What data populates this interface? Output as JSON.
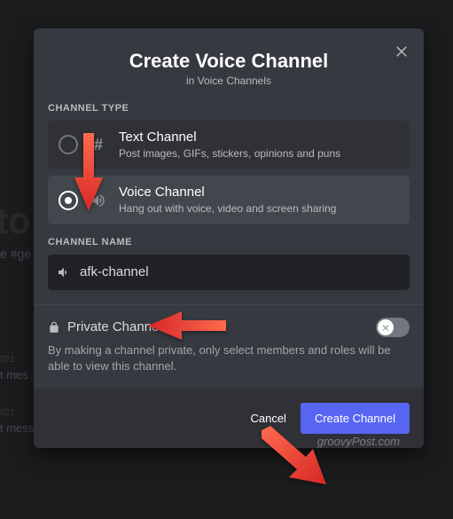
{
  "header": {
    "title": "Create Voice Channel",
    "subtitle": "in Voice Channels"
  },
  "sections": {
    "channel_type_label": "CHANNEL TYPE",
    "channel_name_label": "CHANNEL NAME"
  },
  "options": {
    "text": {
      "title": "Text Channel",
      "desc": "Post images, GIFs, stickers, opinions and puns"
    },
    "voice": {
      "title": "Voice Channel",
      "desc": "Hang out with voice, video and screen sharing"
    }
  },
  "input": {
    "value": "afk-channel"
  },
  "private": {
    "label": "Private Channel",
    "desc": "By making a channel private, only select members and roles will be able to view this channel."
  },
  "footer": {
    "cancel": "Cancel",
    "create": "Create Channel"
  },
  "watermark": "groovyPost.com",
  "bg": {
    "big": "e to",
    "line1": "e #ge",
    "l2a": "021",
    "l2b": "t mes",
    "l3a": "021",
    "l3b": "t mess"
  }
}
